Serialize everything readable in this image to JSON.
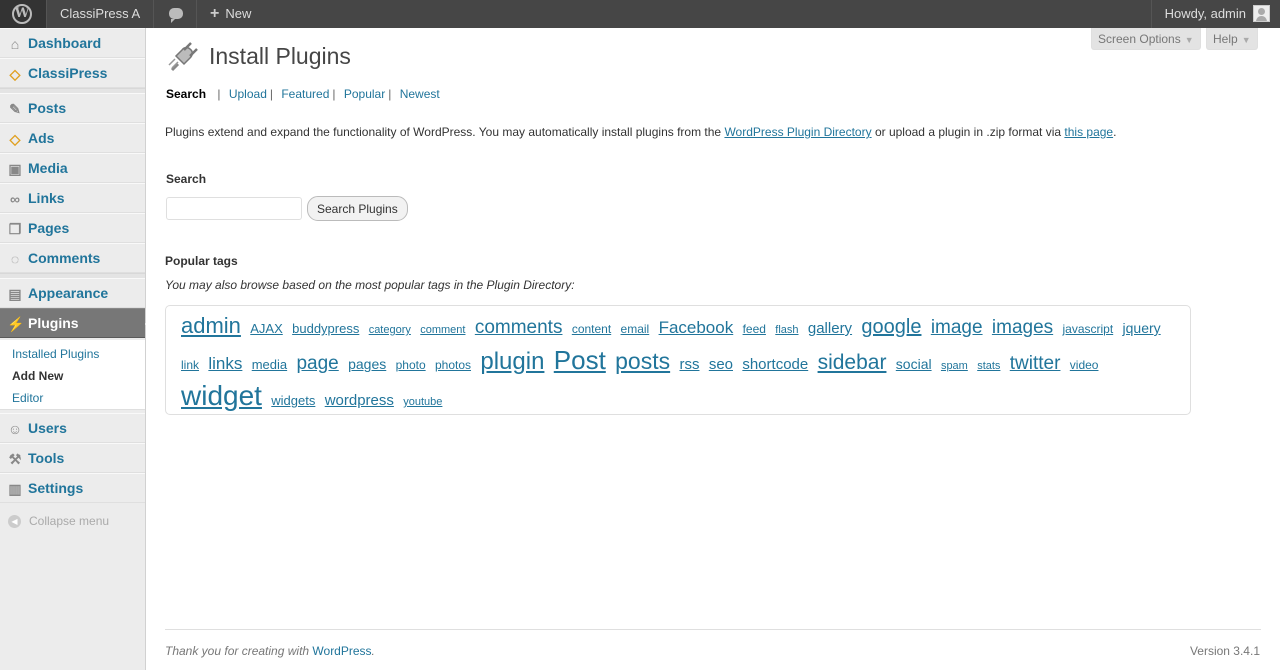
{
  "adminbar": {
    "site_name": "ClassiPress A",
    "new_label": "New",
    "howdy": "Howdy, admin"
  },
  "sidebar": {
    "items": [
      {
        "label": "Dashboard",
        "icon": "dashboard-icon"
      },
      {
        "label": "ClassiPress",
        "icon": "tag-icon"
      },
      {
        "label": "Posts",
        "icon": "pin-icon"
      },
      {
        "label": "Ads",
        "icon": "tag-icon"
      },
      {
        "label": "Media",
        "icon": "media-icon"
      },
      {
        "label": "Links",
        "icon": "link-icon"
      },
      {
        "label": "Pages",
        "icon": "page-icon"
      },
      {
        "label": "Comments",
        "icon": "comment-icon"
      },
      {
        "label": "Appearance",
        "icon": "appearance-icon"
      },
      {
        "label": "Plugins",
        "icon": "plugin-icon"
      },
      {
        "label": "Users",
        "icon": "users-icon"
      },
      {
        "label": "Tools",
        "icon": "tools-icon"
      },
      {
        "label": "Settings",
        "icon": "settings-icon"
      }
    ],
    "submenu": [
      {
        "label": "Installed Plugins"
      },
      {
        "label": "Add New"
      },
      {
        "label": "Editor"
      }
    ],
    "collapse_label": "Collapse menu"
  },
  "screen_meta": {
    "screen_options": "Screen Options",
    "help": "Help"
  },
  "page": {
    "title": "Install Plugins",
    "tabs": [
      "Search",
      "Upload",
      "Featured",
      "Popular",
      "Newest"
    ],
    "intro_before": "Plugins extend and expand the functionality of WordPress. You may automatically install plugins from the ",
    "intro_link1": "WordPress Plugin Directory",
    "intro_middle": " or upload a plugin in .zip format via ",
    "intro_link2": "this page",
    "intro_after": ".",
    "search_heading": "Search",
    "search_placeholder": "",
    "search_button": "Search Plugins",
    "tags_heading": "Popular tags",
    "tags_desc": "You may also browse based on the most popular tags in the Plugin Directory:",
    "tags": [
      {
        "label": "admin",
        "size": 22
      },
      {
        "label": "AJAX",
        "size": 13
      },
      {
        "label": "buddypress",
        "size": 13
      },
      {
        "label": "category",
        "size": 11
      },
      {
        "label": "comment",
        "size": 11
      },
      {
        "label": "comments",
        "size": 19
      },
      {
        "label": "content",
        "size": 12
      },
      {
        "label": "email",
        "size": 12
      },
      {
        "label": "Facebook",
        "size": 17
      },
      {
        "label": "feed",
        "size": 12
      },
      {
        "label": "flash",
        "size": 11
      },
      {
        "label": "gallery",
        "size": 15
      },
      {
        "label": "google",
        "size": 20
      },
      {
        "label": "image",
        "size": 19
      },
      {
        "label": "images",
        "size": 19
      },
      {
        "label": "javascript",
        "size": 12
      },
      {
        "label": "jquery",
        "size": 14
      },
      {
        "label": "link",
        "size": 12
      },
      {
        "label": "links",
        "size": 17
      },
      {
        "label": "media",
        "size": 13
      },
      {
        "label": "page",
        "size": 19
      },
      {
        "label": "pages",
        "size": 14
      },
      {
        "label": "photo",
        "size": 12
      },
      {
        "label": "photos",
        "size": 12
      },
      {
        "label": "plugin",
        "size": 24
      },
      {
        "label": "Post",
        "size": 26
      },
      {
        "label": "posts",
        "size": 23
      },
      {
        "label": "rss",
        "size": 15
      },
      {
        "label": "seo",
        "size": 15
      },
      {
        "label": "shortcode",
        "size": 15
      },
      {
        "label": "sidebar",
        "size": 21
      },
      {
        "label": "social",
        "size": 14
      },
      {
        "label": "spam",
        "size": 11
      },
      {
        "label": "stats",
        "size": 11
      },
      {
        "label": "twitter",
        "size": 19
      },
      {
        "label": "video",
        "size": 12
      },
      {
        "label": "widget",
        "size": 28
      },
      {
        "label": "widgets",
        "size": 13
      },
      {
        "label": "wordpress",
        "size": 15
      },
      {
        "label": "youtube",
        "size": 11
      }
    ]
  },
  "footer": {
    "thanks": "Thank you for creating with ",
    "wp_link": "WordPress",
    "thanks_end": ".",
    "version": "Version 3.4.1"
  },
  "colors": {
    "link": "#21759b",
    "adminbar": "#464646",
    "active_menu": "#777777"
  }
}
